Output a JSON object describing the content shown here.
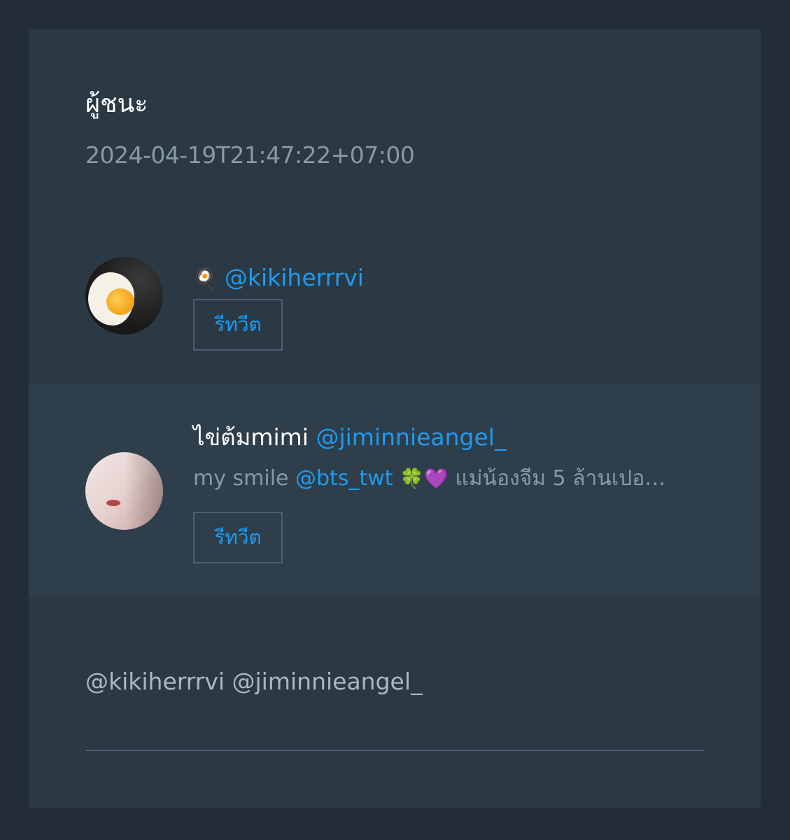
{
  "card": {
    "title": "ผู้ชนะ",
    "timestamp": "2024-04-19T21:47:22+07:00"
  },
  "winners": [
    {
      "display_name_emoji": "🍳",
      "handle": "@kikiherrrvi",
      "retweet_label": "รีทวีต",
      "avatar_icon": "fried-egg-avatar"
    },
    {
      "display_name": "ไข่ต้มmimi",
      "handle": "@jiminnieangel_",
      "bio_prefix": "my smile",
      "bio_mention": "@bts_twt",
      "bio_emoji": "🍀💜",
      "bio_rest": "แม่น้องจีม 5 ล้านเปอ…",
      "retweet_label": "รีทวีต",
      "avatar_icon": "person-photo-avatar"
    }
  ],
  "footer": {
    "mentions": "@kikiherrrvi @jiminnieangel_"
  },
  "colors": {
    "page_bg": "#232d38",
    "card_bg": "#2b3945",
    "highlight_row_bg": "#2e3e4b",
    "link": "#1d9bf0",
    "muted": "#8899a6"
  }
}
